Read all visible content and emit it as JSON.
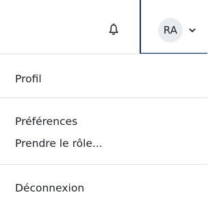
{
  "header": {
    "notifications_icon": "bell-icon",
    "user": {
      "initials": "RA",
      "chevron_icon": "chevron-down-icon"
    }
  },
  "user_menu": {
    "items": [
      {
        "label": "Profil"
      },
      {
        "label": "Préférences"
      },
      {
        "label": "Prendre le rôle..."
      },
      {
        "label": "Déconnexion"
      }
    ]
  },
  "colors": {
    "accent_border": "#0f2f5c",
    "avatar_bg": "#e9ecef",
    "text": "#1d2125",
    "divider": "#dee2e6"
  }
}
